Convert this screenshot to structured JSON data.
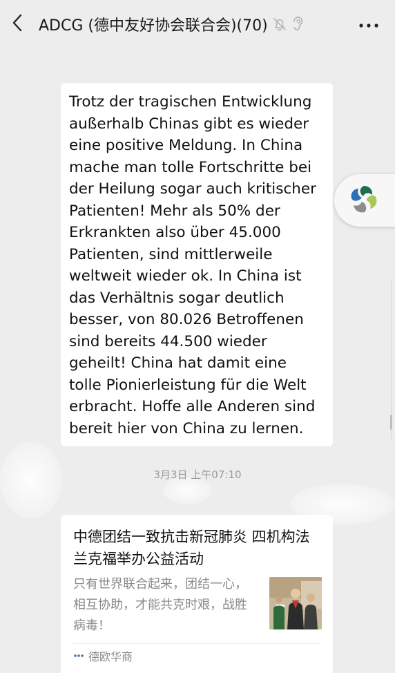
{
  "header": {
    "title": "ADCG (德中友好协会联合会)(70)",
    "icons": [
      "back-arrow-icon",
      "mute-bell-icon",
      "ear-icon",
      "more-icon"
    ]
  },
  "message": {
    "text": "Trotz der tragischen Entwicklung\naußerhalb Chinas gibt es wieder\neine positive Meldung. In China\nmache man tolle Fortschritte bei\nder Heilung sogar auch kritischer\nPatienten! Mehr als 50% der\nErkrankten also über 45.000\nPatienten, sind mittlerweile\nweltweit wieder ok. In China ist\ndas Verhältnis sogar deutlich\nbesser, von 80.026 Betroffenen\nsind bereits 44.500 wieder\ngeheilt! China hat damit eine\ntolle Pionierleistung für die Welt\nerbracht. Hoffe alle Anderen sind\nbereit hier von China zu lernen."
  },
  "timestamp": "3月3日 上午07:10",
  "link_card": {
    "title": "中德团结一致抗击新冠肺炎 四机构法兰克福举办公益活动",
    "description": "只有世界联合起来，团结一心，相互协助，才能共克时艰，战胜病毒！",
    "source": "德欧华商"
  },
  "colors": {
    "background": "#ededed",
    "bubble": "#ffffff",
    "text": "#191919",
    "muted": "#9a9a9a"
  }
}
